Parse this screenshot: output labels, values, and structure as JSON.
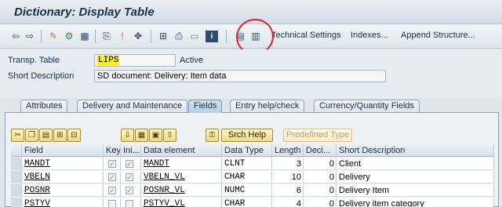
{
  "window": {
    "title": "Dictionary: Display Table"
  },
  "toolbar": {
    "icons": [
      "back-arrow-icon",
      "forward-arrow-icon",
      "other-object-icon",
      "display-change-icon",
      "check-icon",
      "activate-icon",
      "where-used-icon",
      "navigate-icon",
      "hierarchy-icon",
      "print-icon",
      "display-object-list-icon",
      "info-icon",
      "graphic-icon",
      "contents-icon"
    ],
    "technical_settings": "Technical Settings",
    "indexes": "Indexes...",
    "append_structure": "Append Structure..."
  },
  "header": {
    "transp_table_label": "Transp. Table",
    "transp_table_value": "LIPS",
    "status": "Active",
    "short_desc_label": "Short Description",
    "short_desc_value": "SD document: Delivery: Item data"
  },
  "tabs": [
    {
      "label": "Attributes",
      "active": false
    },
    {
      "label": "Delivery and Maintenance",
      "active": false
    },
    {
      "label": "Fields",
      "active": true
    },
    {
      "label": "Entry help/check",
      "active": false
    },
    {
      "label": "Currency/Quantity Fields",
      "active": false
    }
  ],
  "grid_toolbar": {
    "srch_help": "Srch Help",
    "predefined_type": "Predefined Type"
  },
  "table": {
    "columns": [
      "Field",
      "Key",
      "Ini...",
      "Data element",
      "Data Type",
      "Length",
      "Deci...",
      "Short Description"
    ],
    "rows": [
      {
        "field": "MANDT",
        "key": "✓",
        "ini": "✓",
        "data_element": "MANDT",
        "data_type": "CLNT",
        "length": "3",
        "decimals": "0",
        "short_desc": "Client"
      },
      {
        "field": "VBELN",
        "key": "✓",
        "ini": "✓",
        "data_element": "VBELN_VL",
        "data_type": "CHAR",
        "length": "10",
        "decimals": "0",
        "short_desc": "Delivery"
      },
      {
        "field": "POSNR",
        "key": "✓",
        "ini": "✓",
        "data_element": "POSNR_VL",
        "data_type": "NUMC",
        "length": "6",
        "decimals": "0",
        "short_desc": "Delivery Item"
      },
      {
        "field": "PSTYV",
        "key": "",
        "ini": "",
        "data_element": "PSTYV_VL",
        "data_type": "CHAR",
        "length": "4",
        "decimals": "0",
        "short_desc": "Delivery item category"
      }
    ]
  },
  "colors": {
    "annotation": "#d8252e",
    "highlight": "#f7f200"
  }
}
